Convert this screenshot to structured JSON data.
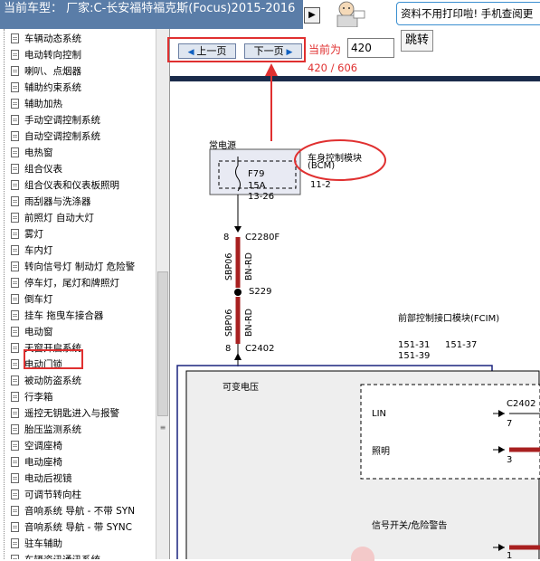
{
  "topbar": {
    "title": "当前车型：  厂家:C-长安福特福克斯(Focus)2015-2016",
    "collapse_glyph": "▶"
  },
  "banner": {
    "text": "资料不用打印啦! 手机查阅更"
  },
  "sidebar": {
    "items": [
      "车辆动态系统",
      "电动转向控制",
      "喇叭、点烟器",
      "辅助约束系统",
      "辅助加热",
      "手动空调控制系统",
      "自动空调控制系统",
      "电热窗",
      "组合仪表",
      "组合仪表和仪表板照明",
      "雨刮器与洗涤器",
      "前照灯 自动大灯",
      "雾灯",
      "车内灯",
      "转向信号灯 制动灯 危险警",
      "停车灯，尾灯和牌照灯",
      "倒车灯",
      "挂车 拖曳车接合器",
      "电动窗",
      "天窗开启系统",
      "电动门锁",
      "被动防盗系统",
      "行李箱",
      "遥控无钥匙进入与报警",
      "胎压监测系统",
      "空调座椅",
      "电动座椅",
      "电动后视镜",
      "可调节转向柱",
      "音响系统 导航 - 不带 SYN",
      "音响系统 导航 - 带 SYNC",
      "驻车辅助",
      "车辆资讯通讯系统"
    ],
    "selected_index": 20
  },
  "toolbar": {
    "prev_label": "上一页",
    "next_label": "下一页",
    "current_label": "当前为",
    "current_page": "420",
    "jump_label": "跳转",
    "page_count": "420 / 606"
  },
  "diagram": {
    "power_label": "常电源",
    "fuse_id": "F79",
    "fuse_rating": "15A",
    "fuse_pins": "13-26",
    "module_name": "车身控制模块",
    "module_abbr": "(BCM)",
    "pin_11_2": "11-2",
    "pin_8a": "8",
    "connector_a": "C2280F",
    "wire_a_code": "SBP06",
    "wire_a_color": "BN-RD",
    "splice": "S229",
    "wire_b_code": "SBP06",
    "wire_b_color": "BN-RD",
    "pin_8b": "8",
    "connector_b": "C2402",
    "fcim_name": "前部控制接口模块(FCIM)",
    "fcim_pin_1": "151-31",
    "fcim_pin_2": "151-37",
    "fcim_pin_3": "151-39",
    "variable_voltage": "可变电压",
    "lin_label": "LIN",
    "lighting_label": "照明",
    "hazard_label": "信号开关/危险警告",
    "right_connector": "C2402",
    "right_pin_7": "7",
    "right_pin_3": "3",
    "right_pin_1": "1"
  }
}
